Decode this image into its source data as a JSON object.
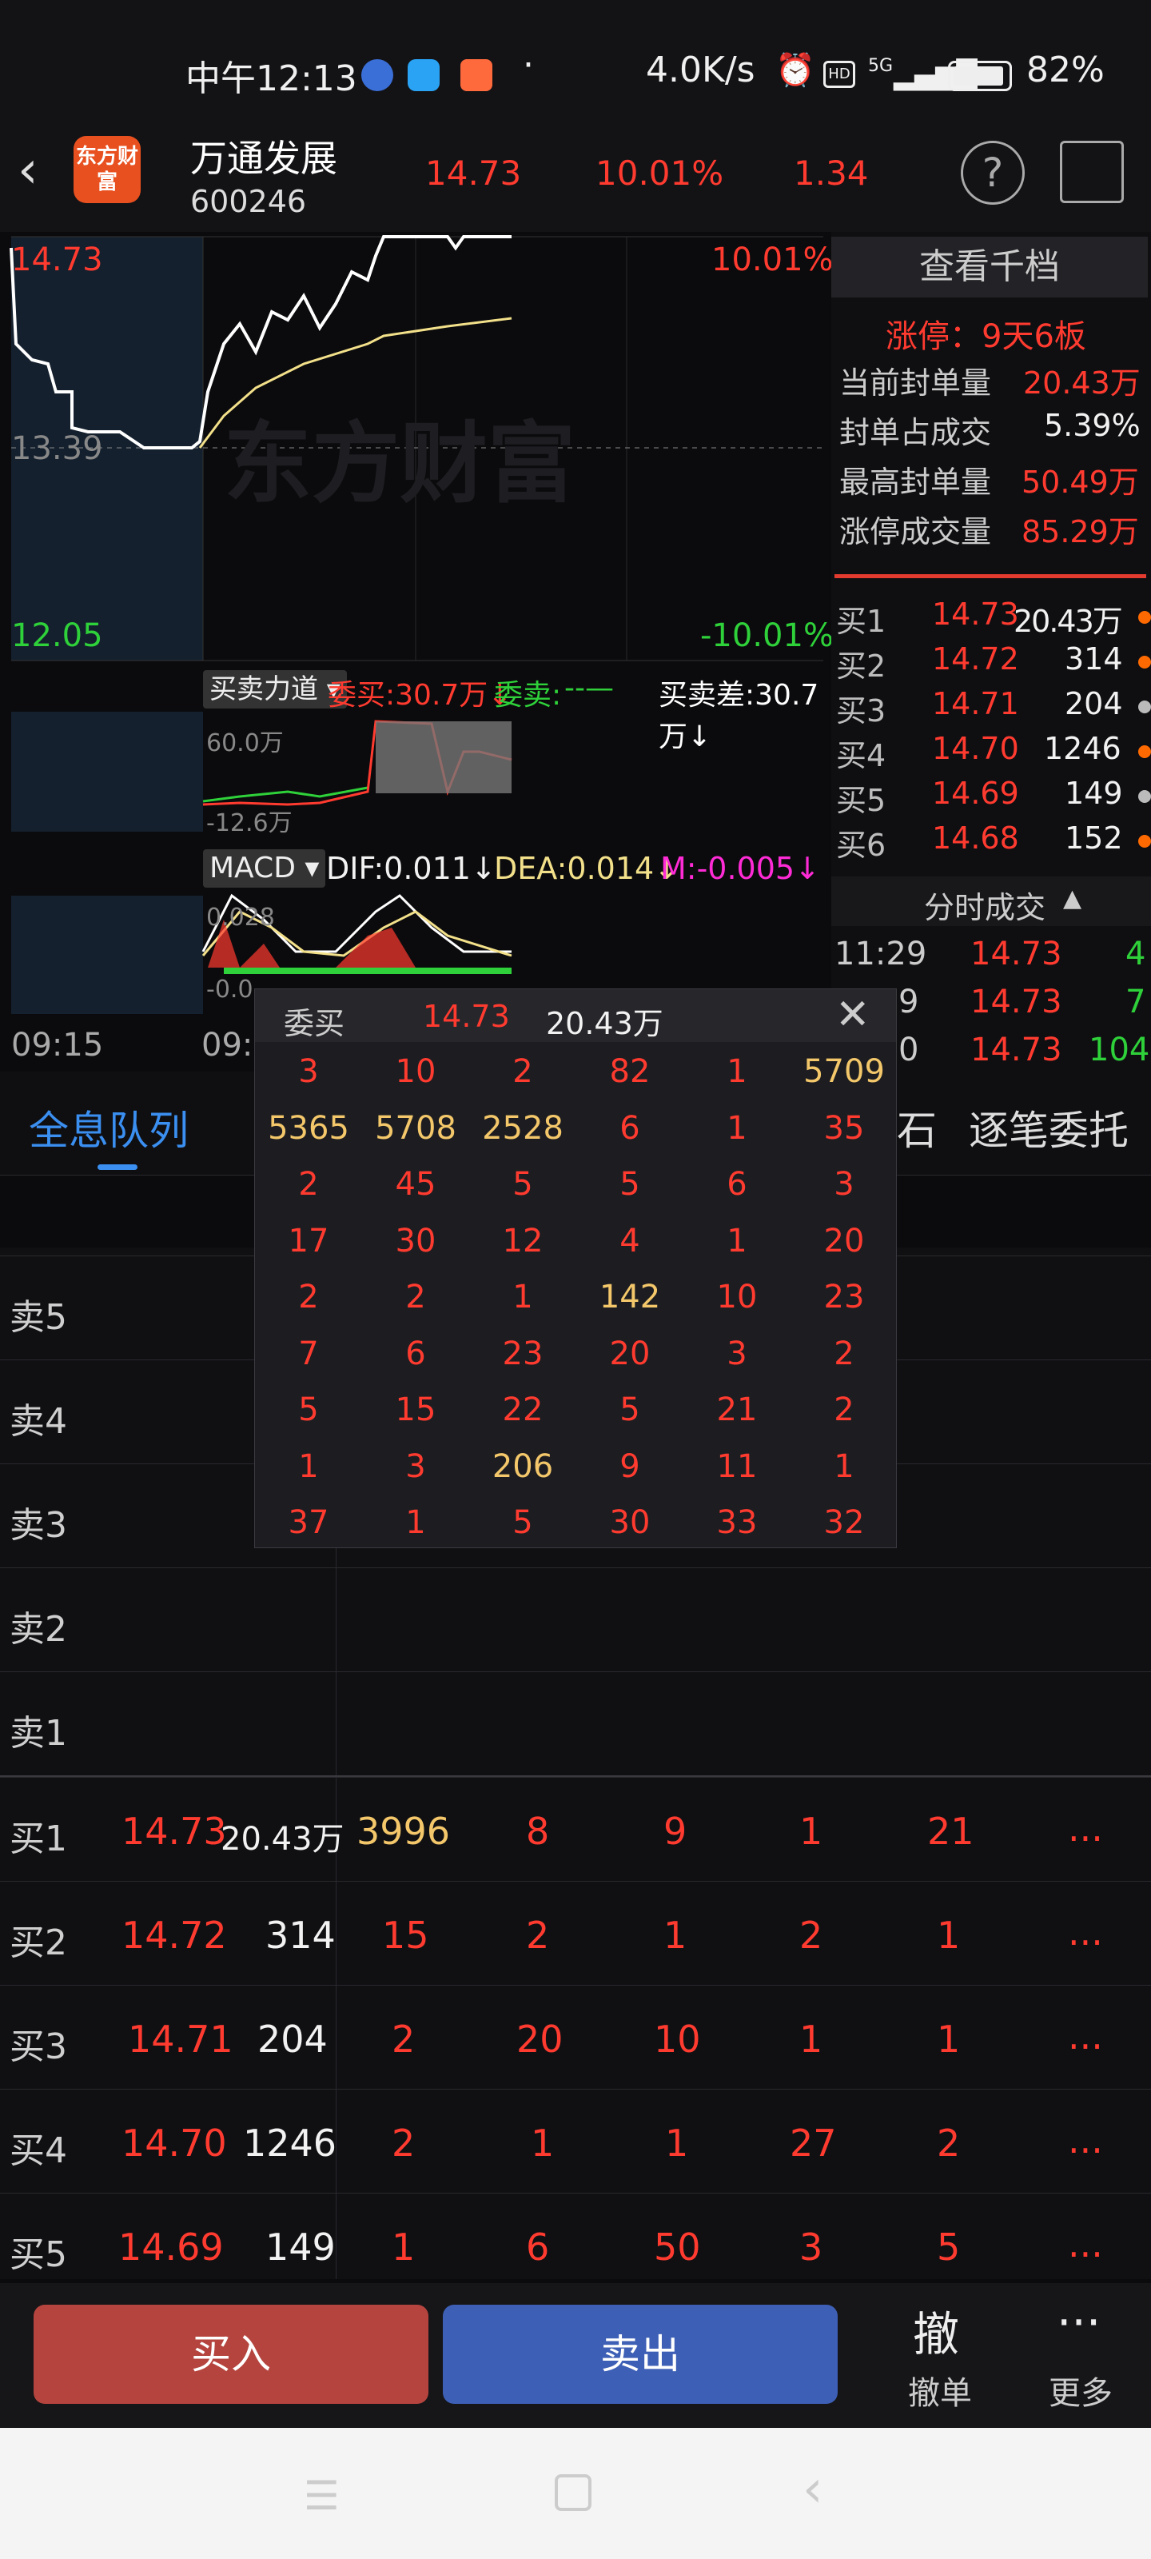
{
  "status_bar": {
    "time": "中午12:13",
    "speed": "4.0K/s",
    "signal": "5G",
    "battery": "82%"
  },
  "header": {
    "logo_text": "东方财富",
    "name": "万通发展",
    "code": "600246",
    "price": "14.73",
    "pct": "10.01%",
    "change": "1.34"
  },
  "chart": {
    "high_price": "14.73",
    "high_pct": "10.01%",
    "mid_price": "13.39",
    "low_price": "12.05",
    "low_pct": "-10.01%",
    "start_time": "09:15",
    "second_time": "09:",
    "watermark": "东方财富",
    "force": {
      "tab": "买卖力道",
      "buy": "委买:30.7万↓",
      "sell_label": "委卖:",
      "sell_value": "--—",
      "diff": "买卖差:30.7万↓",
      "axis_top": "60.0万",
      "axis_mid": "-12.6万"
    },
    "macd": {
      "tab": "MACD",
      "dif": "DIF:0.011↓",
      "dea": "DEA:0.014↓",
      "m": "M:-0.005↓",
      "axis_top": "0.028",
      "axis_bottom": "-0.0"
    }
  },
  "limit_panel": {
    "title": "查看千档",
    "streak": "涨停：9天6板",
    "rows": [
      {
        "label": "当前封单量",
        "value": "20.43万"
      },
      {
        "label": "封单占成交",
        "value": "5.39%"
      },
      {
        "label": "最高封单量",
        "value": "50.49万"
      },
      {
        "label": "涨停成交量",
        "value": "85.29万"
      }
    ]
  },
  "order_book": [
    {
      "label": "买1",
      "price": "14.73",
      "vol": "20.43万"
    },
    {
      "label": "买2",
      "price": "14.72",
      "vol": "314"
    },
    {
      "label": "买3",
      "price": "14.71",
      "vol": "204"
    },
    {
      "label": "买4",
      "price": "14.70",
      "vol": "1246"
    },
    {
      "label": "买5",
      "price": "14.69",
      "vol": "149"
    },
    {
      "label": "买6",
      "price": "14.68",
      "vol": "152"
    }
  ],
  "ticks": {
    "title": "分时成交",
    "rows": [
      {
        "time": "11:29",
        "price": "14.73",
        "vol": "4"
      },
      {
        "time": "9",
        "price": "14.73",
        "vol": "7"
      },
      {
        "time": "0",
        "price": "14.73",
        "vol": "104"
      }
    ]
  },
  "popup": {
    "title": "委买",
    "price": "14.73",
    "volume": "20.43万",
    "grid": [
      [
        "3",
        "10",
        "2",
        "82",
        "1",
        "5709"
      ],
      [
        "5365",
        "5708",
        "2528",
        "6",
        "1",
        "35"
      ],
      [
        "2",
        "45",
        "5",
        "5",
        "6",
        "3"
      ],
      [
        "17",
        "30",
        "12",
        "4",
        "1",
        "20"
      ],
      [
        "2",
        "2",
        "1",
        "142",
        "10",
        "23"
      ],
      [
        "7",
        "6",
        "23",
        "20",
        "3",
        "2"
      ],
      [
        "5",
        "15",
        "22",
        "5",
        "21",
        "2"
      ],
      [
        "1",
        "3",
        "206",
        "9",
        "11",
        "1"
      ],
      [
        "37",
        "1",
        "5",
        "30",
        "33",
        "32"
      ]
    ]
  },
  "tabs": {
    "queue": "全息队列",
    "hidden": "石",
    "order": "逐笔委托"
  },
  "queue": {
    "sells": [
      "卖5",
      "卖4",
      "卖3",
      "卖2",
      "卖1"
    ],
    "buys": [
      {
        "label": "买1",
        "price": "14.73",
        "vol": "20.43万",
        "q": [
          "3996",
          "8",
          "9",
          "1",
          "21"
        ],
        "more": "..."
      },
      {
        "label": "买2",
        "price": "14.72",
        "vol": "314",
        "q": [
          "15",
          "2",
          "1",
          "2",
          "1"
        ],
        "more": "..."
      },
      {
        "label": "买3",
        "price": "14.71",
        "vol": "204",
        "q": [
          "2",
          "20",
          "10",
          "1",
          "1"
        ],
        "more": "..."
      },
      {
        "label": "买4",
        "price": "14.70",
        "vol": "1246",
        "q": [
          "2",
          "1",
          "1",
          "27",
          "2"
        ],
        "more": "..."
      },
      {
        "label": "买5",
        "price": "14.69",
        "vol": "149",
        "q": [
          "1",
          "6",
          "50",
          "3",
          "5"
        ],
        "more": "..."
      }
    ]
  },
  "actions": {
    "buy": "买入",
    "sell": "卖出",
    "cancel_icon": "撤",
    "cancel": "撤单",
    "more": "更多"
  }
}
